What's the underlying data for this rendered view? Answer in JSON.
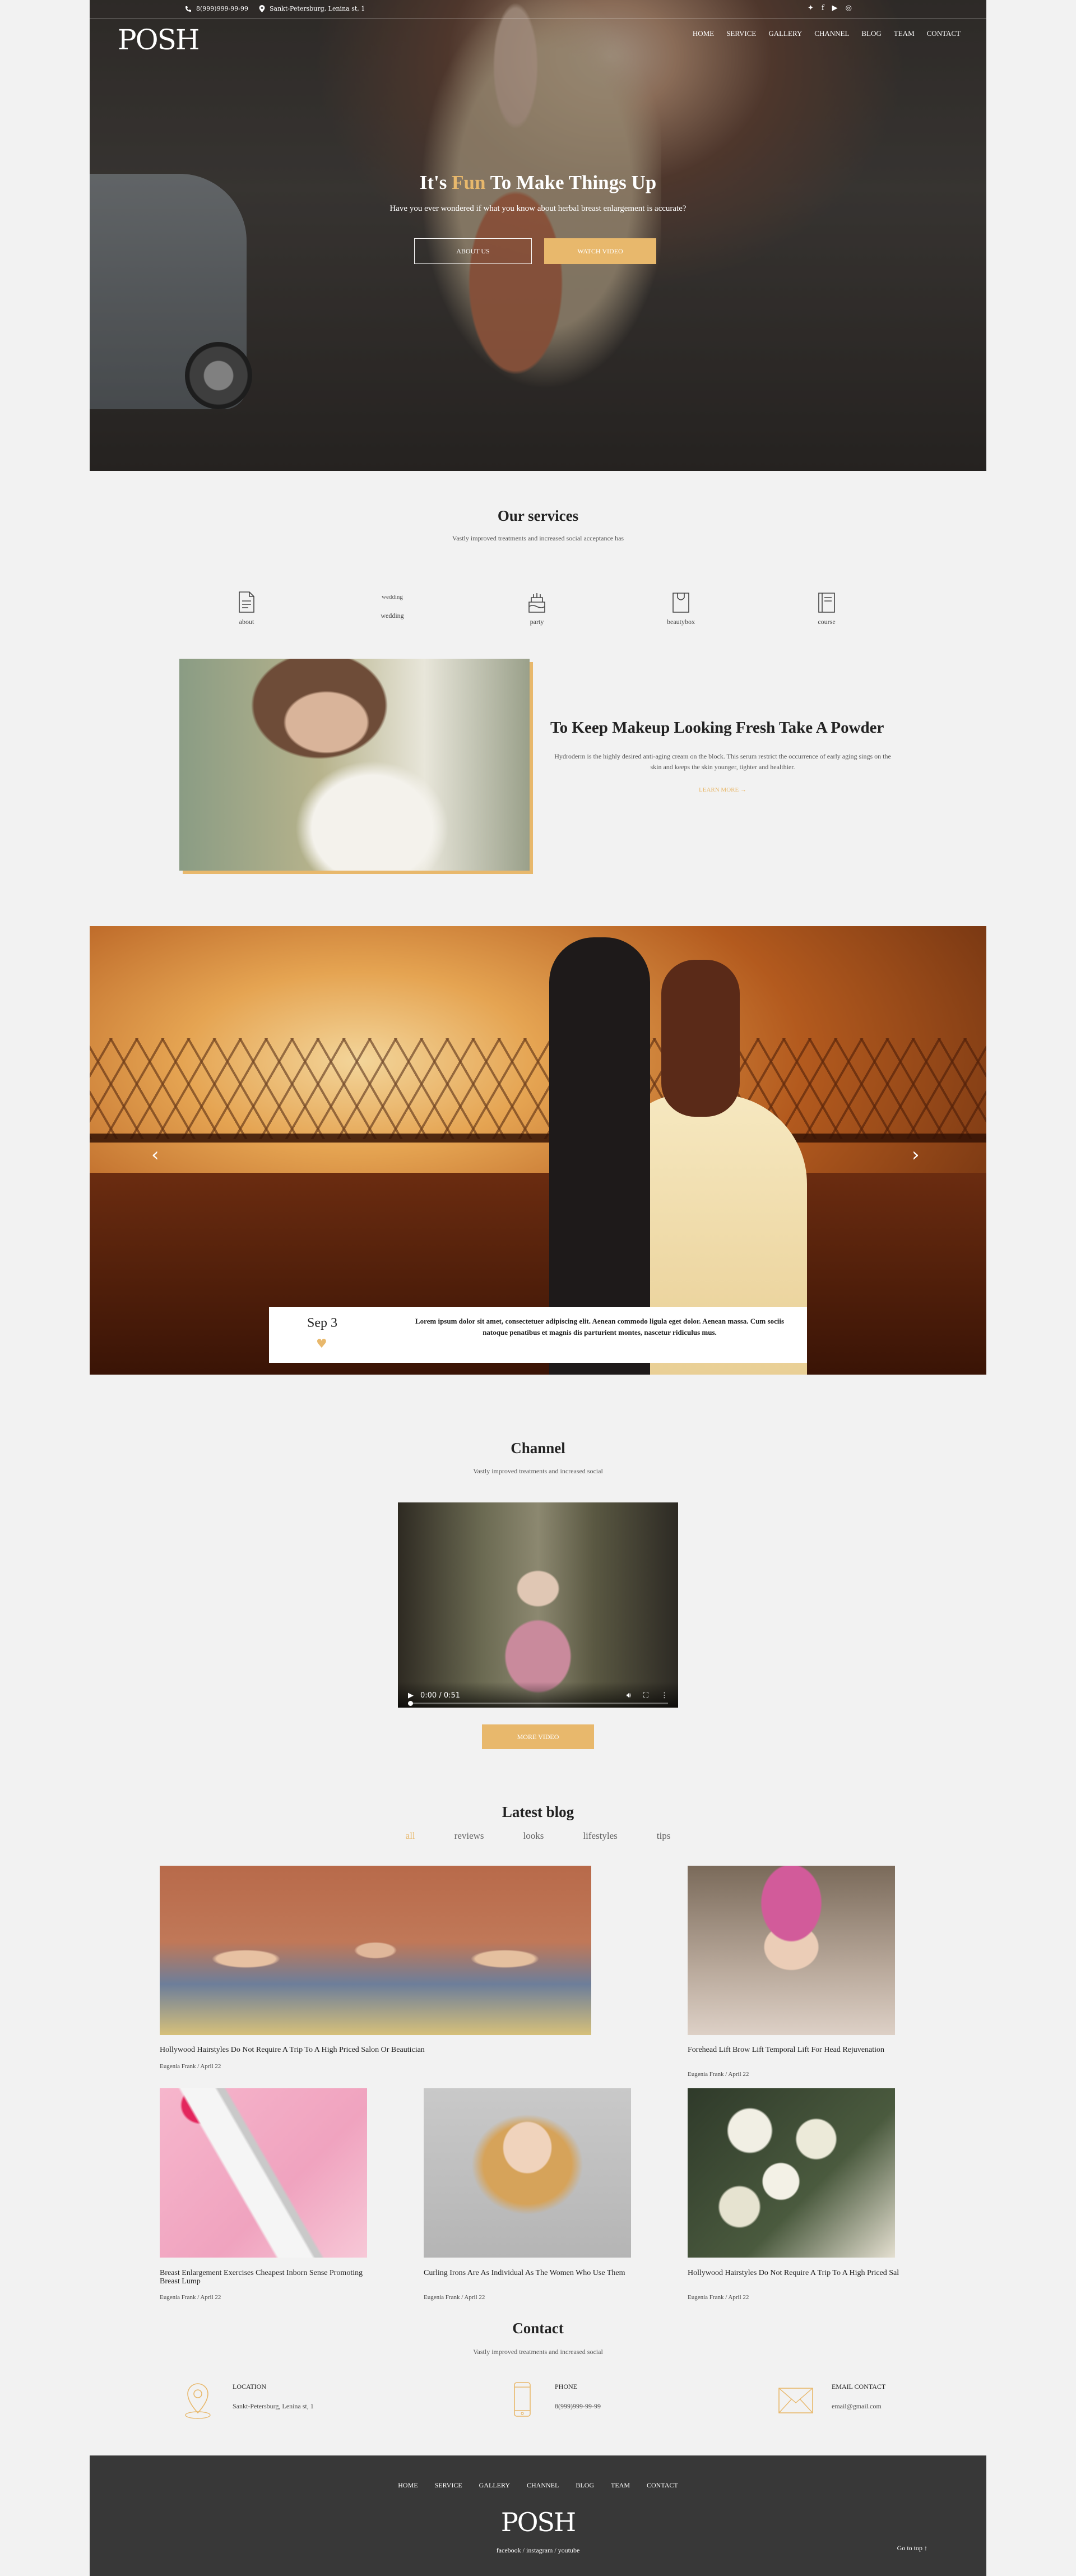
{
  "hero": {
    "phone": "8(999)999-99-99",
    "address": "Sankt-Petersburg, Lenina st, 1",
    "logo": "POSH",
    "nav": [
      "HOME",
      "SERVICE",
      "GALLERY",
      "CHANNEL",
      "BLOG",
      "TEAM",
      "CONTACT"
    ],
    "title_pre": "It's ",
    "title_accent": "Fun",
    "title_post": " To Make Things Up",
    "subtitle": "Have you ever wondered if what you know about herbal breast enlargement is accurate?",
    "btn_about": "ABOUT US",
    "btn_watch": "WATCH VIDEO"
  },
  "services": {
    "title": "Our services",
    "subtitle": "Vastly improved treatments and increased social acceptance has",
    "items": [
      {
        "label": "about",
        "icon": "document-icon"
      },
      {
        "label": "wedding",
        "alt": "wedding",
        "icon": "broken-image-icon"
      },
      {
        "label": "party",
        "icon": "cake-icon"
      },
      {
        "label": "beautybox",
        "icon": "bag-icon"
      },
      {
        "label": "course",
        "icon": "notebook-icon"
      }
    ]
  },
  "feature": {
    "title": "To Keep Makeup Looking Fresh Take A Powder",
    "text": "Hydroderm is the highly desired anti-aging cream on the block. This serum restrict the occurrence of early aging sings on the skin and keeps the skin younger, tighter and healthier.",
    "link": "LEARN MORE →"
  },
  "slider": {
    "date": "Sep 3",
    "text": "Lorem ipsum dolor sit amet, consectetuer adipiscing elit. Aenean commodo ligula eget dolor. Aenean massa. Cum sociis natoque penatibus et magnis dis parturient montes, nascetur ridiculus mus.",
    "prev": "‹",
    "next": "›"
  },
  "channel": {
    "title": "Channel",
    "subtitle": "Vastly improved treatments and increased social",
    "time": "0:00 / 0:51",
    "progress": 0,
    "btn": "MORE VIDEO"
  },
  "blog": {
    "title": "Latest blog",
    "filters": [
      "all",
      "reviews",
      "looks",
      "lifestyles",
      "tips"
    ],
    "active_filter": "all",
    "posts": [
      {
        "title": "Hollywood Hairstyles Do Not Require A Trip To A High Priced Salon Or Beautician",
        "meta": "Eugenia Frank / April 22"
      },
      {
        "title": "Forehead Lift Brow Lift Temporal Lift For Head Rejuvenation",
        "meta": "Eugenia Frank / April 22"
      },
      {
        "title": "Breast Enlargement Exercises Cheapest Inborn Sense Promoting Breast Lump",
        "meta": "Eugenia Frank / April 22"
      },
      {
        "title": "Curling Irons Are As Individual As The Women Who Use Them",
        "meta": "Eugenia Frank / April 22"
      },
      {
        "title": "Hollywood Hairstyles Do Not Require A Trip To A High Priced Sal",
        "meta": "Eugenia Frank / April 22"
      }
    ]
  },
  "contact": {
    "title": "Contact",
    "subtitle": "Vastly improved treatments and increased social",
    "location_label": "LOCATION",
    "location_value": "Sankt-Petersburg, Lenina st, 1",
    "phone_label": "PHONE",
    "phone_value": "8(999)999-99-99",
    "email_label": "EMAIL CONTACT",
    "email_value": "email@gmail.com"
  },
  "footer": {
    "nav": [
      "HOME",
      "SERVICE",
      "GALLERY",
      "CHANNEL",
      "BLOG",
      "TEAM",
      "CONTACT"
    ],
    "logo": "POSH",
    "social": "facebook / instagram / youtube",
    "gotop": "Go to top  ↑"
  },
  "colors": {
    "accent": "#e8b86c",
    "footer_bg": "#383838",
    "page_bg": "#f2f2f2"
  }
}
